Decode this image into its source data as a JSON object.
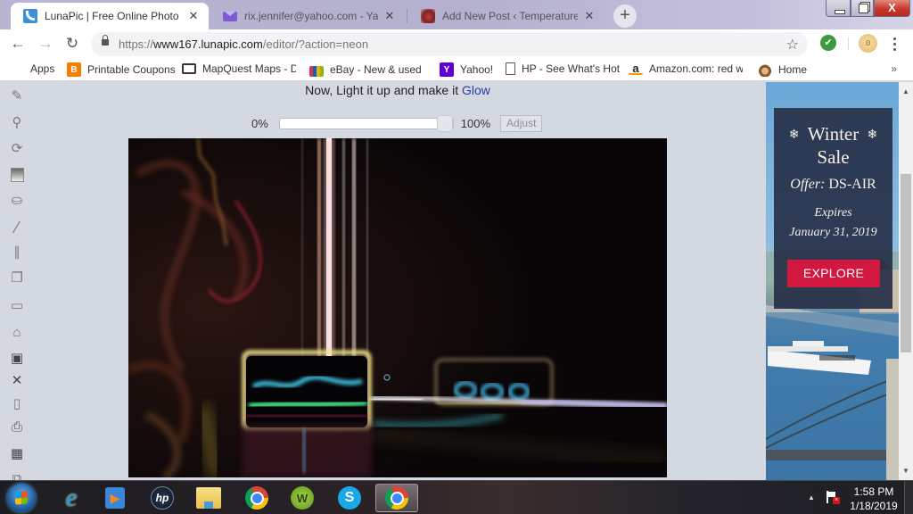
{
  "browser": {
    "tabs": [
      {
        "title": "LunaPic | Free Online Photo Editor",
        "favicon": "lunapic-moon-icon",
        "active": true
      },
      {
        "title": "rix.jennifer@yahoo.com - Yahoo Mail",
        "favicon": "mail-envelope-icon",
        "active": false
      },
      {
        "title": "Add New Post ‹ Temperature's Rising",
        "favicon": "blog-thumbnail-icon",
        "active": false
      }
    ],
    "tab_close_glyph": "✕",
    "new_tab_glyph": "+",
    "window_controls": {
      "close_glyph": "X"
    },
    "nav": {
      "back": "←",
      "forward": "→",
      "reload": "↻"
    },
    "address": {
      "scheme": "https://",
      "host": "www167.lunapic.com",
      "path": "/editor/?action=neon"
    },
    "star_glyph": "☆",
    "extension_glyph": "✔",
    "profile_glyph": "ʚ",
    "menu_glyph": "⋮",
    "bookmarks": [
      {
        "label": "Apps",
        "icon": "apps-grid-icon"
      },
      {
        "label": "Printable Coupons",
        "icon": "blogger-icon"
      },
      {
        "label": "MapQuest Maps - Dr",
        "icon": "map-icon"
      },
      {
        "label": "eBay - New & used e",
        "icon": "shopping-bag-icon"
      },
      {
        "label": "Yahoo!",
        "icon": "yahoo-icon"
      },
      {
        "label": "HP - See What's Hot",
        "icon": "page-icon"
      },
      {
        "label": "Amazon.com: red wo",
        "icon": "amazon-icon"
      },
      {
        "label": "Home",
        "icon": "cowboy-icon"
      }
    ],
    "bookmarks_overflow": "»"
  },
  "editor": {
    "tools": [
      {
        "name": "pencil-tool",
        "glyph": "✎"
      },
      {
        "name": "zoom-tool",
        "glyph": "⚲"
      },
      {
        "name": "rotate-tool",
        "glyph": "⟳"
      },
      {
        "name": "gradient-tool",
        "glyph": "▤"
      },
      {
        "name": "paint-bucket-tool",
        "glyph": "⛀"
      },
      {
        "name": "eyedropper-tool",
        "glyph": "⁄"
      },
      {
        "name": "brush-tool",
        "glyph": "∥"
      },
      {
        "name": "layers-tool",
        "glyph": "❐"
      },
      {
        "name": "eraser-tool",
        "glyph": "▭"
      },
      {
        "name": "open-folder-tool",
        "glyph": "⌂"
      },
      {
        "name": "save-tool",
        "glyph": "▣"
      },
      {
        "name": "delete-tool",
        "glyph": "✕"
      },
      {
        "name": "new-document-tool",
        "glyph": "▯"
      },
      {
        "name": "print-tool",
        "glyph": "⎙"
      },
      {
        "name": "clipboard-tool",
        "glyph": "▦"
      },
      {
        "name": "copy-tool",
        "glyph": "⧉"
      }
    ],
    "headline": {
      "prefix": "Now, Light it up and make it ",
      "highlight": "Glow"
    },
    "slider": {
      "min_label": "0%",
      "max_label": "100%",
      "value_percent": 100,
      "adjust_label": "Adjust"
    },
    "image": {
      "effect": "neon"
    }
  },
  "ad": {
    "title_line1": "Winter",
    "title_line2": "Sale",
    "snowflake": "❄",
    "offer_label": "Offer:",
    "offer_code": "DS-AIR",
    "expires_label": "Expires",
    "expires_date": "January 31, 2019",
    "cta": "EXPLORE"
  },
  "scrollbar": {
    "up": "▲",
    "down": "▼"
  },
  "taskbar": {
    "apps": [
      {
        "name": "internet-explorer",
        "glyph": "e",
        "active": false
      },
      {
        "name": "media-player",
        "glyph": "▶",
        "active": false
      },
      {
        "name": "hp-support",
        "glyph": "hp",
        "active": false
      },
      {
        "name": "file-explorer",
        "glyph": "",
        "active": false
      },
      {
        "name": "chrome",
        "glyph": "",
        "active": false
      },
      {
        "name": "webroot",
        "glyph": "W",
        "active": false
      },
      {
        "name": "skype",
        "glyph": "S",
        "active": false
      },
      {
        "name": "chrome-active",
        "glyph": "",
        "active": true
      }
    ],
    "tray_arrow": "▲",
    "time": "1:58 PM",
    "date": "1/18/2019"
  }
}
